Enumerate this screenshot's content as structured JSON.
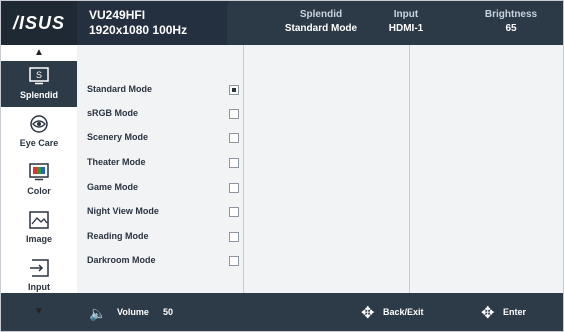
{
  "brand": {
    "logo": "/ISUS"
  },
  "model": {
    "name": "VU249HFI",
    "resolution": "1920x1080 100Hz"
  },
  "status": [
    {
      "label": "Splendid",
      "value": "Standard Mode"
    },
    {
      "label": "Input",
      "value": "HDMI-1"
    },
    {
      "label": "Brightness",
      "value": "65"
    }
  ],
  "sidebar": {
    "items": [
      {
        "label": "Splendid",
        "icon": "splendid-icon",
        "active": true
      },
      {
        "label": "Eye Care",
        "icon": "eye-care-icon",
        "active": false
      },
      {
        "label": "Color",
        "icon": "color-icon",
        "active": false
      },
      {
        "label": "Image",
        "icon": "image-icon",
        "active": false
      },
      {
        "label": "Input",
        "icon": "input-icon",
        "active": false
      }
    ]
  },
  "modes": [
    {
      "label": "Standard Mode",
      "checked": true
    },
    {
      "label": "sRGB Mode",
      "checked": false
    },
    {
      "label": "Scenery Mode",
      "checked": false
    },
    {
      "label": "Theater Mode",
      "checked": false
    },
    {
      "label": "Game Mode",
      "checked": false
    },
    {
      "label": "Night View Mode",
      "checked": false
    },
    {
      "label": "Reading Mode",
      "checked": false
    },
    {
      "label": "Darkroom Mode",
      "checked": false
    }
  ],
  "footer": {
    "volume_label": "Volume",
    "volume_value": "50",
    "back_label": "Back/Exit",
    "enter_label": "Enter"
  },
  "colors": {
    "header": "#2c3946",
    "active": "#2d3a47",
    "panel": "#f2f3f5"
  }
}
